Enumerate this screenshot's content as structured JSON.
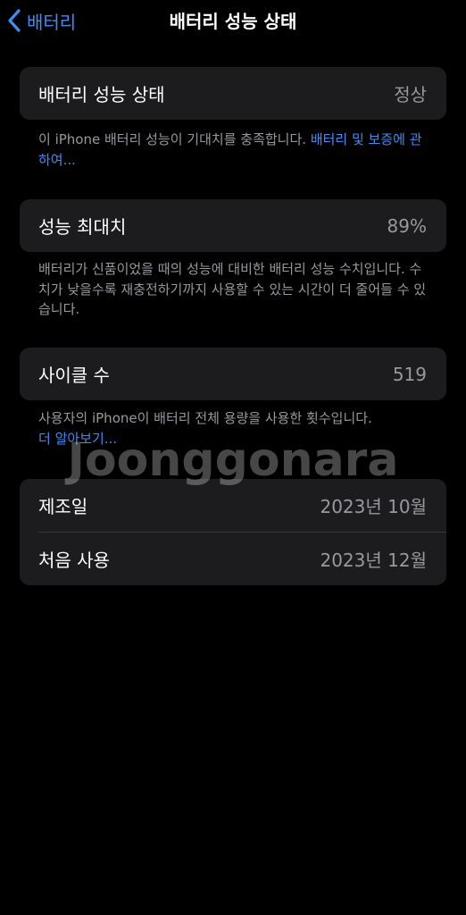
{
  "nav": {
    "back_label": "배터리",
    "title": "배터리 성능 상태"
  },
  "health": {
    "label": "배터리 성능 상태",
    "value": "정상",
    "footnote_text": "이 iPhone 배터리 성능이 기대치를 충족합니다. ",
    "footnote_link": "배터리 및 보증에 관하여..."
  },
  "max_capacity": {
    "label": "성능 최대치",
    "value": "89%",
    "footnote_text": "배터리가 신품이었을 때의 성능에 대비한 배터리 성능 수치입니다. 수치가 낮을수록 재충전하기까지 사용할 수 있는 시간이 더 줄어들 수 있습니다."
  },
  "cycle_count": {
    "label": "사이클 수",
    "value": "519",
    "footnote_text": "사용자의 iPhone이 배터리 전체 용량을 사용한 횟수입니다.",
    "footnote_link": "더 알아보기..."
  },
  "dates": {
    "manufacture_label": "제조일",
    "manufacture_value": "2023년 10월",
    "first_use_label": "처음 사용",
    "first_use_value": "2023년 12월"
  },
  "watermark": "Joonggonara",
  "colors": {
    "background": "#000000",
    "cell": "#1c1c1e",
    "accent": "#3a8ef6",
    "secondary_text": "#98989e"
  },
  "icons": {
    "back": "chevron-left-icon"
  }
}
